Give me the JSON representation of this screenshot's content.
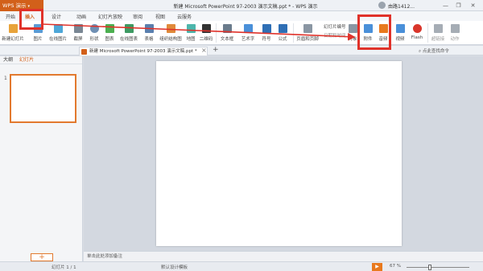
{
  "app": {
    "name": "WPS 演示"
  },
  "window": {
    "title": "新建 Microsoft PowerPoint 97-2003 演示文稿.ppt * - WPS 演示",
    "user": "由路1412...",
    "controls": [
      "—",
      "❐",
      "✕"
    ]
  },
  "menu": {
    "tabs": [
      "开始",
      "插入",
      "设计",
      "动画",
      "幻灯片放映",
      "审阅",
      "视图",
      "云服务"
    ],
    "active": "插入"
  },
  "ribbon": {
    "buttons": [
      {
        "label": "新建幻灯片",
        "color": "#e8a33a"
      },
      {
        "label": "图片",
        "color": "#5b9bd5"
      },
      {
        "label": "在线图片",
        "color": "#4ea7d8"
      },
      {
        "label": "截屏",
        "color": "#7a8794"
      },
      {
        "label": "形状",
        "color": "#6f8fb3"
      },
      {
        "label": "图表",
        "color": "#4caf50"
      },
      {
        "label": "在线图表",
        "color": "#3d9a62"
      },
      {
        "label": "表格",
        "color": "#5a7fae"
      },
      {
        "label": "组织结构图",
        "color": "#e08a3a"
      },
      {
        "label": "地图",
        "color": "#4db6ac"
      },
      {
        "label": "二维码",
        "color": "#333333"
      },
      {
        "label": "文本框",
        "color": "#6a7b8c"
      },
      {
        "label": "艺术字",
        "color": "#4a90d9"
      },
      {
        "label": "符号",
        "color": "#2f6fb5"
      },
      {
        "label": "公式",
        "color": "#2f6fb5"
      },
      {
        "label": "页眉和页脚",
        "color": "#8a96a3"
      },
      {
        "label": "对象",
        "color": "#8a96a3"
      },
      {
        "label": "附件",
        "color": "#4a90d9"
      },
      {
        "label": "音频",
        "color": "#e8791e"
      },
      {
        "label": "视频",
        "color": "#4a90d9"
      },
      {
        "label": "Flash",
        "color": "#d9362b"
      },
      {
        "label": "超链接",
        "color": "#a6adb5"
      },
      {
        "label": "动作",
        "color": "#a6adb5"
      }
    ],
    "small_items": [
      "幻灯片编号",
      "日期和时间"
    ]
  },
  "tabbar": {
    "doc_tab": "新建 Microsoft PowerPoint 97-2003 演示文稿.ppt *",
    "close": "×",
    "add": "+",
    "search_hint": "点此查找命令"
  },
  "left_panel": {
    "tabs": [
      "大纲",
      "幻灯片"
    ],
    "slide_number": "1",
    "add_button": "+"
  },
  "notes": {
    "placeholder": "单击此处添加备注"
  },
  "status": {
    "slide": "幻灯片 1 / 1",
    "theme": "默认设计模板",
    "zoom": "67 %",
    "zoom_value": 67
  },
  "colors": {
    "accent": "#d2601a",
    "highlight": "#e0322a"
  }
}
